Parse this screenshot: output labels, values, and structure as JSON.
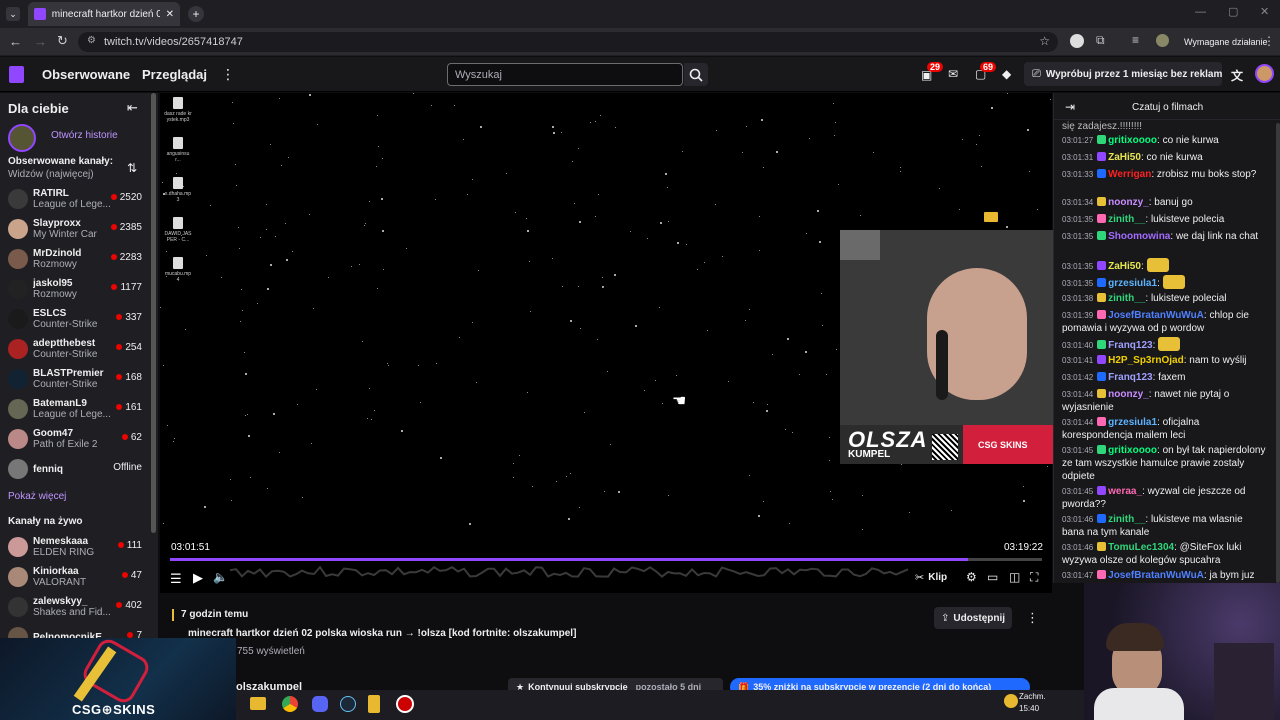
{
  "browser": {
    "tab_title": "minecraft hartkor dzień 02",
    "url": "twitch.tv/videos/2657418747",
    "action_required": "Wymagane działanie"
  },
  "topnav": {
    "followed": "Obserwowane",
    "browse": "Przeglądaj",
    "search_placeholder": "Wyszukaj",
    "notif_badge_1": "29",
    "notif_badge_2": "69",
    "promo": "Wypróbuj przez 1 miesiąc bez reklam"
  },
  "sidebar": {
    "title": "Dla ciebie",
    "history_link": "Otwórz historie",
    "followed_header": "Obserwowane kanały:",
    "followed_sort": "Widzów (najwięcej)",
    "followed": [
      {
        "name": "RATIRL",
        "game": "League of Lege...",
        "count": "2520",
        "color": "#3a3a3a"
      },
      {
        "name": "Slayproxx",
        "game": "My Winter Car",
        "count": "2385",
        "color": "#c9a48a"
      },
      {
        "name": "MrDzinold",
        "game": "Rozmowy",
        "count": "2283",
        "color": "#7a5a4a"
      },
      {
        "name": "jaskol95",
        "game": "Rozmowy",
        "count": "1177",
        "color": "#222"
      },
      {
        "name": "ESLCS",
        "game": "Counter-Strike",
        "count": "337",
        "color": "#1a1a1a"
      },
      {
        "name": "adeptthebest",
        "game": "Counter-Strike",
        "count": "254",
        "color": "#a22"
      },
      {
        "name": "BLASTPremier",
        "game": "Counter-Strike",
        "count": "168",
        "color": "#123"
      },
      {
        "name": "BatemanL9",
        "game": "League of Lege...",
        "count": "161",
        "color": "#665"
      },
      {
        "name": "Goom47",
        "game": "Path of Exile 2",
        "count": "62",
        "color": "#b88"
      },
      {
        "name": "fenniq",
        "game": "",
        "count": "Offline",
        "color": "#777"
      }
    ],
    "show_more": "Pokaż więcej",
    "live_header": "Kanały na żywo",
    "live": [
      {
        "name": "Nemeskaaa",
        "game": "ELDEN RING",
        "count": "111",
        "color": "#c99"
      },
      {
        "name": "Kiniorkaa",
        "game": "VALORANT",
        "count": "47",
        "color": "#a87"
      },
      {
        "name": "zalewskyy_",
        "game": "Shakes and Fid...",
        "count": "402",
        "color": "#333"
      },
      {
        "name": "PelnomocnikE...",
        "game": "",
        "count": "7",
        "color": "#654"
      }
    ]
  },
  "video": {
    "desktop_files": [
      "dasz rade krystek.mp3",
      "angusinsur...",
      "x.dhaha.mp3",
      "DAWID JASPER - C...",
      "mucabu.mp4"
    ],
    "time_current": "03:01:51",
    "time_total": "03:19:22",
    "progress": 0.915,
    "clip_label": "Klip",
    "webcam_brand": "OLSZA",
    "webcam_sub": "KUMPEL",
    "webcam_sponsor": "CSG SKINS"
  },
  "info": {
    "time_ago": "7 godzin temu",
    "title": "minecraft hartkor dzień 02 polska wioska run → !olsza [kod fortnite: olszakumpel]",
    "views": "755 wyświetleń",
    "share": "Udostępnij",
    "channel": "olszakumpel",
    "sub_continue": "Kontynuuj subskrypcję",
    "sub_left": "pozostało 5 dni",
    "sub_promo": "35% zniżki na subskrypcję w prezencie (2 dni do końca)"
  },
  "chat": {
    "header": "Czatuj o filmach",
    "first_line": "się zadajesz.!!!!!!!!",
    "messages": [
      {
        "ts": "03:01:27",
        "user": "gritixoooo",
        "color": "#00ff7f",
        "text": "co nie kurwa"
      },
      {
        "ts": "03:01:31",
        "user": "ZaHi50",
        "color": "#e6e650",
        "text": "co nie kurwa"
      },
      {
        "ts": "03:01:33",
        "user": "Werrigan",
        "color": "#ff2020",
        "text": "zrobisz mu boks stop?"
      },
      {
        "ts": "03:01:34",
        "user": "noonzy_",
        "color": "#c88cff",
        "text": "banuj go"
      },
      {
        "ts": "03:01:35",
        "user": "zinith__",
        "color": "#2fd67a",
        "text": "lukisteve polecia"
      },
      {
        "ts": "03:01:35",
        "user": "Shoomowina",
        "color": "#a36bff",
        "text": "we daj link na chat"
      },
      {
        "ts": "03:01:35",
        "user": "ZaHi50",
        "color": "#e6e650",
        "text": ""
      },
      {
        "ts": "03:01:35",
        "user": "grzesiula1",
        "color": "#5cb3ff",
        "text": ""
      },
      {
        "ts": "03:01:38",
        "user": "zinith__",
        "color": "#2fd67a",
        "text": "lukisteve polecial"
      },
      {
        "ts": "03:01:39",
        "user": "JosefBratanWuWuA",
        "color": "#5080ff",
        "text": "chlop cie pomawia i wyzywa od p wordow"
      },
      {
        "ts": "03:01:40",
        "user": "Franq123",
        "color": "#a0a0ff",
        "text": ""
      },
      {
        "ts": "03:01:41",
        "user": "H2P_Sp3rnOjad",
        "color": "#f0d000",
        "text": "nam to wyślij"
      },
      {
        "ts": "03:01:42",
        "user": "Franq123",
        "color": "#a0a0ff",
        "text": "faxem"
      },
      {
        "ts": "03:01:44",
        "user": "noonzy_",
        "color": "#c88cff",
        "text": "nawet nie pytaj o wyjasnienie"
      },
      {
        "ts": "03:01:44",
        "user": "grzesiula1",
        "color": "#5cb3ff",
        "text": "oficjalna korespondencja mailem leci"
      },
      {
        "ts": "03:01:45",
        "user": "gritixoooo",
        "color": "#00ff7f",
        "text": "on był tak napierdolony ze tam wszystkie hamulce prawie zostaly odpiete"
      },
      {
        "ts": "03:01:45",
        "user": "weraa_",
        "color": "#ff69b4",
        "text": "wyzwal cie jeszcze od pworda??"
      },
      {
        "ts": "03:01:46",
        "user": "zinith__",
        "color": "#2fd67a",
        "text": "lukisteve ma wlasnie bana na tym kanale"
      },
      {
        "ts": "03:01:46",
        "user": "TomuLec1304",
        "color": "#2fd67a",
        "text": "@SiteFox luki wyzywa olsze od kolegów spucahra"
      },
      {
        "ts": "03:01:47",
        "user": "JosefBratanWuWuA",
        "color": "#5080ff",
        "text": "ja bym juz tam jechał do niego"
      }
    ]
  },
  "overlay": {
    "csgo_brand": "CSG⊕SKINS"
  },
  "taskbar": {
    "weather": "Zachm.",
    "time": "15:40"
  }
}
